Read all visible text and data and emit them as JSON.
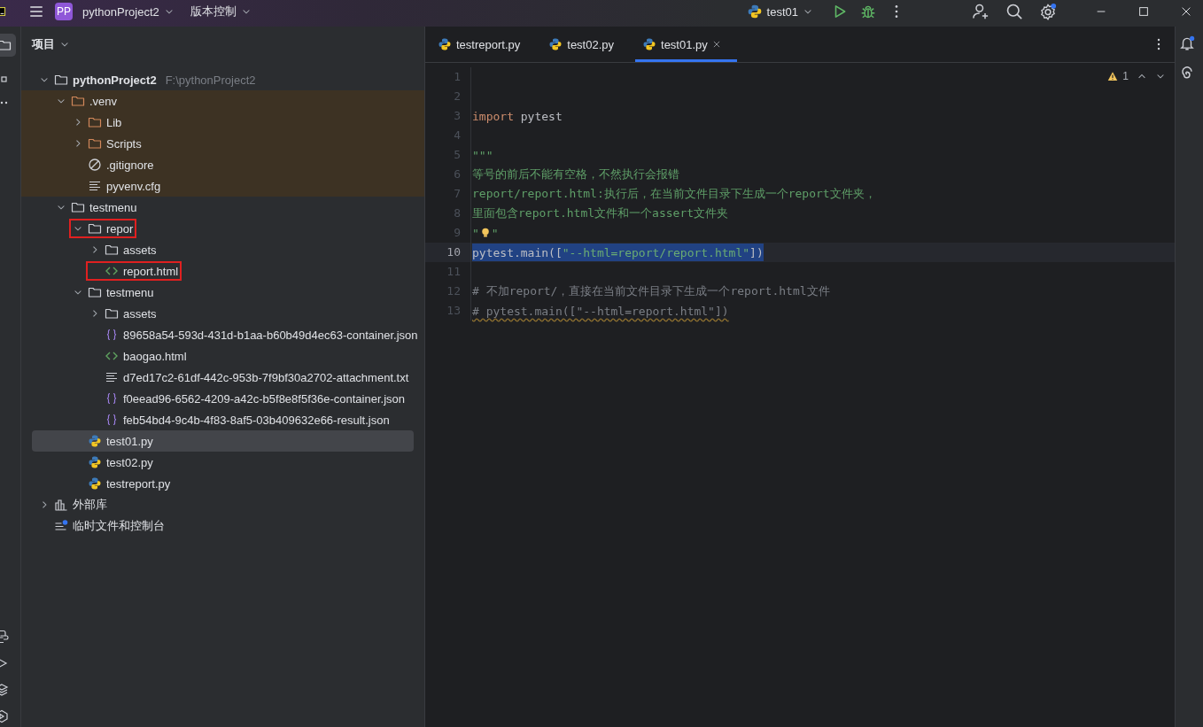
{
  "title_bar": {
    "project_badge": "PP",
    "project": "pythonProject2",
    "vcs": "版本控制",
    "run_config": "test01"
  },
  "project_panel": {
    "title": "项目",
    "tree": [
      {
        "kind": "folder",
        "label": "pythonProject2",
        "path": "F:\\pythonProject2",
        "expanded": true,
        "children": [
          {
            "kind": "folder",
            "label": ".venv",
            "expanded": true,
            "excluded": true,
            "children": [
              {
                "kind": "folder",
                "label": "Lib",
                "expanded": false
              },
              {
                "kind": "folder",
                "label": "Scripts",
                "expanded": false
              },
              {
                "kind": "ignore",
                "label": ".gitignore"
              },
              {
                "kind": "config",
                "label": "pyvenv.cfg"
              }
            ]
          },
          {
            "kind": "folder",
            "label": "testmenu",
            "expanded": true,
            "children": [
              {
                "kind": "folder",
                "label": "repor",
                "expanded": true,
                "highlighted": true,
                "children": [
                  {
                    "kind": "folder",
                    "label": "assets",
                    "expanded": false
                  },
                  {
                    "kind": "html",
                    "label": "report.html",
                    "highlighted": true
                  }
                ]
              },
              {
                "kind": "folder",
                "label": "testmenu",
                "expanded": true,
                "children": [
                  {
                    "kind": "folder",
                    "label": "assets",
                    "expanded": false
                  },
                  {
                    "kind": "json",
                    "label": "89658a54-593d-431d-b1aa-b60b49d4ec63-container.json"
                  },
                  {
                    "kind": "html",
                    "label": "baogao.html"
                  },
                  {
                    "kind": "text",
                    "label": "d7ed17c2-61df-442c-953b-7f9bf30a2702-attachment.txt"
                  },
                  {
                    "kind": "json",
                    "label": "f0eead96-6562-4209-a42c-b5f8e8f5f36e-container.json"
                  },
                  {
                    "kind": "json",
                    "label": "feb54bd4-9c4b-4f83-8af5-03b409632e66-result.json"
                  }
                ]
              },
              {
                "kind": "python",
                "label": "test01.py",
                "selected": true
              },
              {
                "kind": "python",
                "label": "test02.py",
                "selected": false
              },
              {
                "kind": "python",
                "label": "testreport.py",
                "selected": false
              }
            ]
          }
        ]
      },
      {
        "kind": "library",
        "label": "外部库",
        "expanded": false
      },
      {
        "kind": "scratch",
        "label": "临时文件和控制台"
      }
    ]
  },
  "editor": {
    "tabs": [
      {
        "label": "testreport.py",
        "selected": false
      },
      {
        "label": "test02.py",
        "selected": false
      },
      {
        "label": "test01.py",
        "selected": true
      }
    ],
    "warnings": "1",
    "lines": [
      {
        "number": "1",
        "selected": false
      },
      {
        "number": "2",
        "selected": false
      },
      {
        "number": "3",
        "selected": false,
        "segments": [
          {
            "kind": "keyword",
            "text": "import"
          },
          {
            "kind": "plain",
            "text": " pytest"
          }
        ]
      },
      {
        "number": "4",
        "selected": false
      },
      {
        "number": "5",
        "selected": false,
        "segments": [
          {
            "kind": "doc",
            "text": "\"\"\""
          }
        ]
      },
      {
        "number": "6",
        "selected": false,
        "segments": [
          {
            "kind": "doc",
            "text": "等号的前后不能有空格，不然执行会报错"
          }
        ]
      },
      {
        "number": "7",
        "selected": false,
        "segments": [
          {
            "kind": "doc",
            "text": "report/report.html:执行后，在当前文件目录下生成一个report文件夹，"
          }
        ]
      },
      {
        "number": "8",
        "selected": false,
        "segments": [
          {
            "kind": "doc",
            "text": "里面包含report.html文件和一个assert文件夹"
          }
        ]
      },
      {
        "number": "9",
        "selected": false,
        "intention": true,
        "segments": [
          {
            "kind": "doc",
            "text": "\""
          },
          {
            "kind": "doc",
            "text": "\""
          }
        ]
      },
      {
        "number": "10",
        "selected": true,
        "segments": [
          {
            "kind": "plain",
            "text": "pytest.main(["
          },
          {
            "kind": "string",
            "text": "\"--html=report/report.html\""
          },
          {
            "kind": "plain",
            "text": "])"
          }
        ]
      },
      {
        "number": "11",
        "selected": false
      },
      {
        "number": "12",
        "selected": false,
        "segments": [
          {
            "kind": "comment",
            "text": "# 不加report/，直接在当前文件目录下生成一个report.html文件"
          }
        ]
      },
      {
        "number": "13",
        "selected": false,
        "warning": true,
        "segments": [
          {
            "kind": "comment",
            "text": "# pytest.main([\"--html=report.html\"])"
          }
        ]
      }
    ]
  }
}
